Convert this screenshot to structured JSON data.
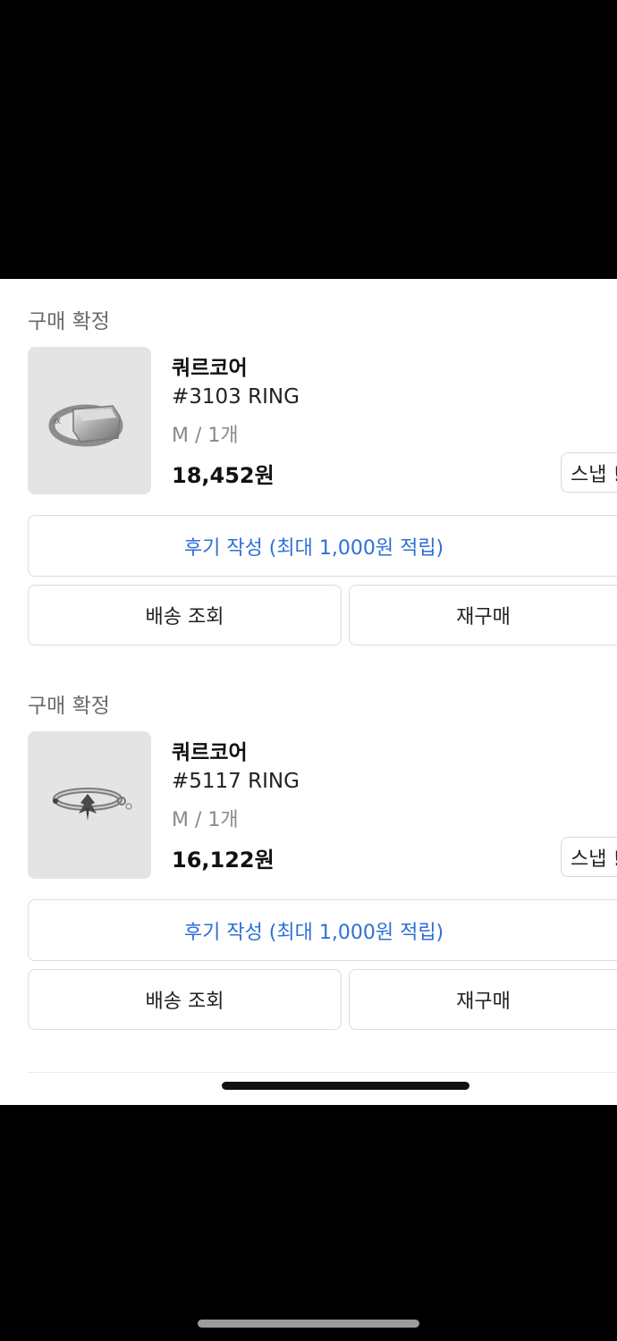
{
  "orders": [
    {
      "status": "구매 확정",
      "brand": "쿼르코어",
      "product_name": "#3103 RING",
      "option": "M / 1개",
      "price": "18,452원",
      "snap_button": "스냅 !",
      "review_button": "후기 작성 (최대 1,000원 적립)",
      "shipping_button": "배송 조회",
      "rebuy_button": "재구매",
      "image_icon": "signet-ring-icon"
    },
    {
      "status": "구매 확정",
      "brand": "쿼르코어",
      "product_name": "#5117 RING",
      "option": "M / 1개",
      "price": "16,122원",
      "snap_button": "스냅 !",
      "review_button": "후기 작성 (최대 1,000원 적립)",
      "shipping_button": "배송 조회",
      "rebuy_button": "재구매",
      "image_icon": "cross-ring-icon"
    }
  ],
  "colors": {
    "accent": "#2f6fd6",
    "thumb_bg": "#e4e4e4",
    "status_text": "#6b6b6b"
  }
}
